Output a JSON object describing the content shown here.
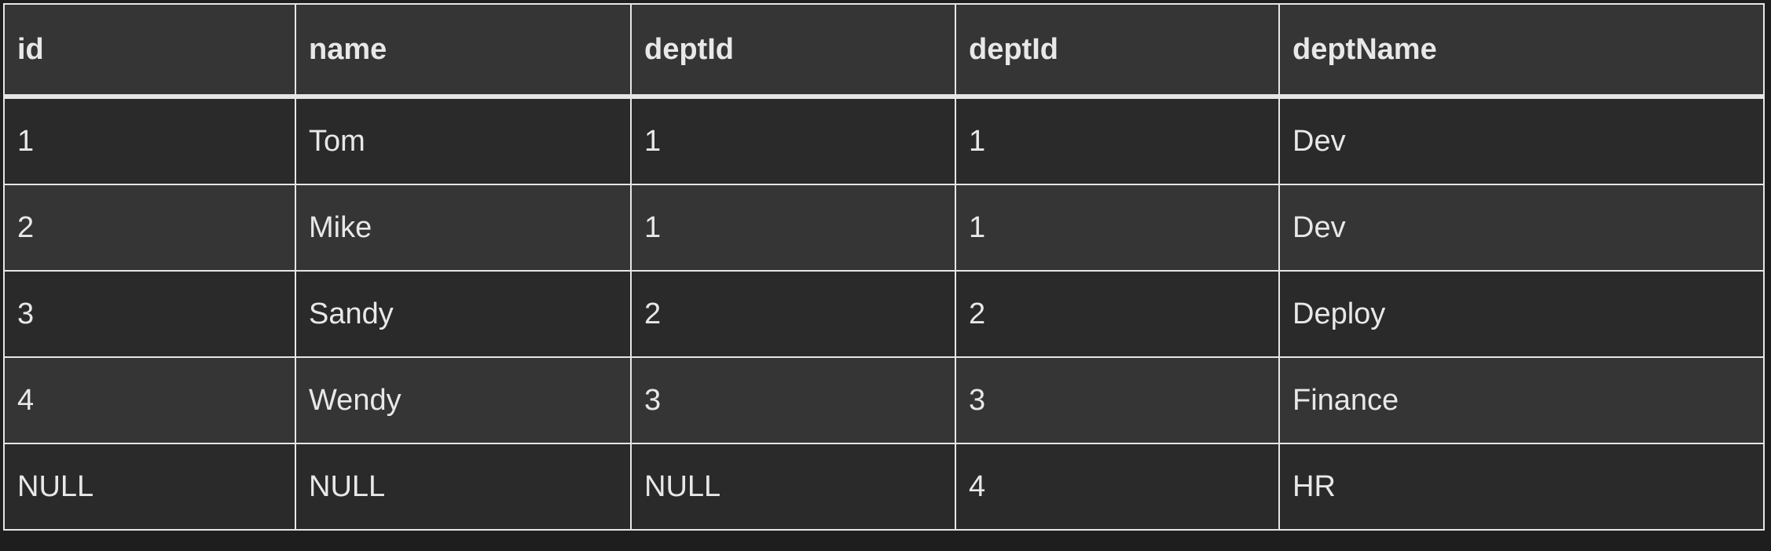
{
  "table": {
    "headers": [
      "id",
      "name",
      "deptId",
      "deptId",
      "deptName"
    ],
    "rows": [
      [
        "1",
        "Tom",
        "1",
        "1",
        "Dev"
      ],
      [
        "2",
        "Mike",
        "1",
        "1",
        "Dev"
      ],
      [
        "3",
        "Sandy",
        "2",
        "2",
        "Deploy"
      ],
      [
        "4",
        "Wendy",
        "3",
        "3",
        "Finance"
      ],
      [
        "NULL",
        "NULL",
        "NULL",
        "4",
        "HR"
      ]
    ]
  },
  "colors": {
    "background": "#1e1e1e",
    "header_bg": "#353535",
    "row_dark": "#2a2a2a",
    "row_light": "#353535",
    "border": "#e6e6e6",
    "text": "#e8e8e8"
  }
}
